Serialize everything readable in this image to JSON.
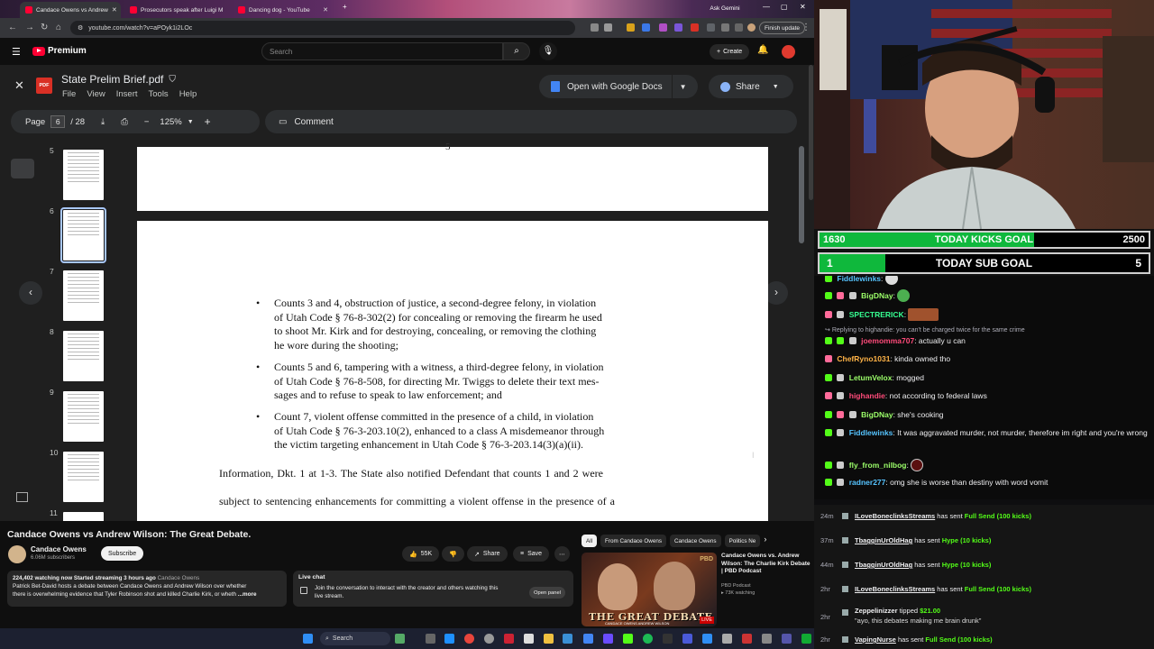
{
  "browser": {
    "tabs": [
      {
        "title": "Candace Owens vs Andrew",
        "active": true
      },
      {
        "title": "Prosecutors speak after Luigi M",
        "active": false
      },
      {
        "title": "Dancing dog - YouTube",
        "active": false
      }
    ],
    "ask_gemini": "Ask Gemini",
    "url": "youtube.com/watch?v=aPOyk1i2LOc",
    "finish_update": "Finish update"
  },
  "youtube": {
    "logo_text": "Premium",
    "search_placeholder": "Search",
    "create_label": "Create"
  },
  "pdf": {
    "filename": "State Prelim Brief.pdf",
    "icon_label": "PDF",
    "menu": [
      "File",
      "View",
      "Insert",
      "Tools",
      "Help"
    ],
    "open_with": "Open with Google Docs",
    "share": "Share",
    "page_label": "Page",
    "current_page": "6",
    "total_pages": "/ 28",
    "zoom": "125%",
    "comment": "Comment",
    "thumbnail_pages": [
      "5",
      "6",
      "7",
      "8",
      "9",
      "10",
      "11"
    ],
    "selected_page": "6",
    "page5_footer": "5",
    "bullets": [
      [
        "Counts 3 and 4, obstruction of justice, a second-degree felony, in violation",
        "of Utah Code § 76-8-302(2) for concealing or removing the firearm he used",
        "to shoot Mr. Kirk and for destroying, concealing, or removing the clothing",
        "he wore during the shooting;"
      ],
      [
        "Counts 5 and 6, tampering with a witness, a third-degree felony, in violation",
        "of Utah Code § 76-8-508, for directing Mr. Twiggs to delete their text mes-",
        "sages and to refuse to speak to law enforcement; and"
      ],
      [
        "Count 7, violent offense committed in the presence of a child, in violation",
        "of Utah Code § 76-3-203.10(2), enhanced to a class A misdemeanor through",
        "the victim targeting enhancement in Utah Code § 76-3-203.14(3)(a)(ii)."
      ]
    ],
    "body_lines": [
      "Information, Dkt. 1 at 1-3. The State also notified Defendant that counts 1 and 2 were",
      "subject to sentencing enhancements for committing a violent offense in the presence of a"
    ]
  },
  "video": {
    "title": "Candace Owens vs Andrew Wilson: The Great Debate.",
    "channel": "Candace Owens",
    "subscribers": "6.06M subscribers",
    "subscribe": "Subscribe",
    "likes": "55K",
    "share": "Share",
    "save": "Save",
    "desc_stats": "224,402 watching now  Started streaming 3 hours ago",
    "desc_channel": "Candace Owens",
    "desc_line1": "Patrick Bet-David hosts a debate between Candace Owens and Andrew Wilson over whether",
    "desc_line2": "there is overwhelming evidence that Tyler Robinson shot and killed Charlie Kirk, or wheth",
    "desc_more": "...more",
    "live_chat_title": "Live chat",
    "live_chat_line1": "Join the conversation to interact with the creator and others watching this",
    "live_chat_line2": "live stream.",
    "open_panel": "Open panel",
    "chips": [
      "All",
      "From Candace Owens",
      "Candace Owens",
      "Politics Ne"
    ],
    "rec_title": "Candace Owens vs. Andrew Wilson: The Charlie Kirk Debate | PBD Podcast",
    "rec_channel": "PBD Podcast",
    "rec_watching": "73K watching",
    "rec_thumb_brand": "PBD",
    "rec_thumb_text": "THE GREAT DEBATE",
    "rec_thumb_sub": "CANDACE OWENS  ANDREW WILSON",
    "rec_live": "LIVE"
  },
  "taskbar": {
    "search": "Search"
  },
  "goals": {
    "kicks": {
      "current": "1630",
      "label": "TODAY KICKS GOAL",
      "target": "2500",
      "progress": 0.652
    },
    "subs": {
      "current": "1",
      "label": "TODAY SUB GOAL",
      "target": "5",
      "progress": 0.2
    }
  },
  "chat": {
    "messages": [
      {
        "user": "Fiddlewinks",
        "color": "#56c4ff",
        "text": ""
      },
      {
        "user": "BigDNay",
        "color": "#9cff6a",
        "text": ""
      },
      {
        "user": "SPECTRERICK",
        "color": "#36ff92",
        "text": ""
      },
      {
        "reply": "Replying to highandie: you can't be charged twice for the same crime",
        "user": "joemomma707",
        "color": "#ff4b7a",
        "text": "actually u can"
      },
      {
        "user": "ChefRyno1031",
        "color": "#ffb347",
        "text": "kinda owned tho"
      },
      {
        "user": "LetumVelox",
        "color": "#9cff6a",
        "text": "mogged"
      },
      {
        "user": "highandie",
        "color": "#ff4b7a",
        "text": "not according to federal laws"
      },
      {
        "user": "BigDNay",
        "color": "#9cff6a",
        "text": "she's cooking"
      },
      {
        "user": "Fiddlewinks",
        "color": "#56c4ff",
        "text": "It was aggravated murder, not murder, therefore im right and you're wrong"
      },
      {
        "user": "fly_from_nilbog",
        "color": "#9cff6a",
        "text": ""
      },
      {
        "user": "radner277",
        "color": "#56c4ff",
        "text": "omg she is worse than destiny with word vomit"
      }
    ]
  },
  "alerts": [
    {
      "time": "24m",
      "user": "ILoveBoneclinksStreams",
      "action": "has sent",
      "item": "Full Send (100 kicks)"
    },
    {
      "time": "37m",
      "user": "TbagginUrOldHag",
      "action": "has sent",
      "item": "Hype (10 kicks)"
    },
    {
      "time": "44m",
      "user": "TbagginUrOldHag",
      "action": "has sent",
      "item": "Hype (10 kicks)"
    },
    {
      "time": "2hr",
      "user": "ILoveBoneclinksStreams",
      "action": "has sent",
      "item": "Full Send (100 kicks)"
    },
    {
      "time": "2hr",
      "user": "Zeppelinizzer",
      "action": "tipped",
      "item": "$21.00",
      "note": "\"ayo, this debates making me brain drunk\""
    },
    {
      "time": "2hr",
      "user": "VapingNurse",
      "action": "has sent",
      "item": "Full Send (100 kicks)"
    }
  ]
}
